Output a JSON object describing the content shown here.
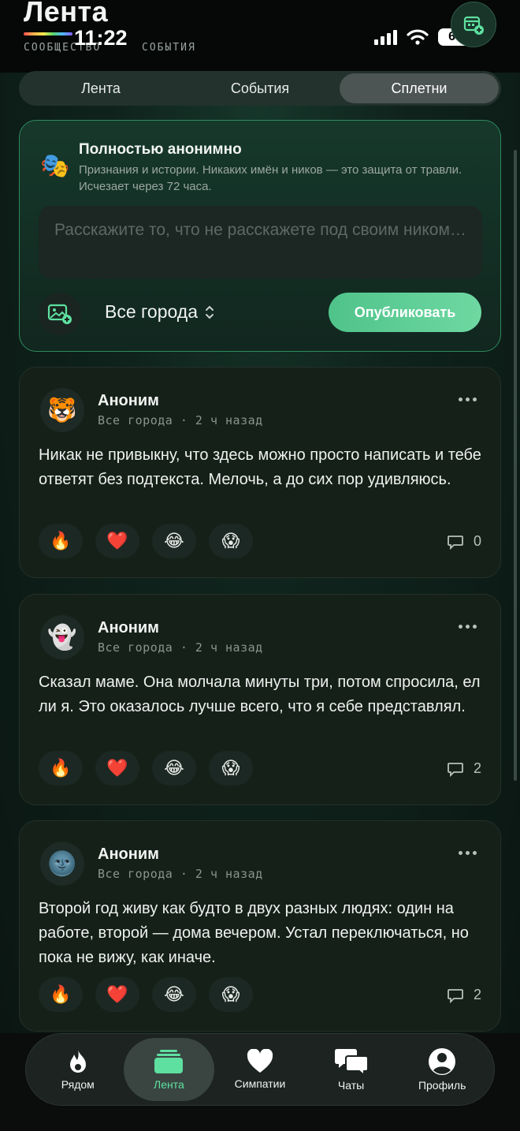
{
  "app": {
    "title": "Лента",
    "subnav": [
      "СООБЩЕСТВО",
      "СОБЫТИЯ"
    ]
  },
  "status_bar": {
    "time": "11:22",
    "battery": "66"
  },
  "segments": [
    {
      "label": "Лента",
      "active": false
    },
    {
      "label": "События",
      "active": false
    },
    {
      "label": "Сплетни",
      "active": true
    }
  ],
  "composer": {
    "icon": "theater-masks-icon",
    "title": "Полностью анонимно",
    "description": "Признания и истории. Никаких имён и ников — это защита от травли. Исчезает через 72 часа.",
    "placeholder": "Расскажите то, что не расскажете под своим ником…",
    "city": "Все города",
    "publish_label": "Опубликовать"
  },
  "posts": [
    {
      "avatar": "🐯",
      "author": "Аноним",
      "city": "Все города",
      "time": "2 ч назад",
      "text": "Никак не привыкну, что здесь можно просто написать и тебе ответят без подтекста. Мелочь, а до сих пор удивляюсь.",
      "comments": "0"
    },
    {
      "avatar": "👻",
      "author": "Аноним",
      "city": "Все города",
      "time": "2 ч назад",
      "text": "Сказал маме. Она молчала минуты три, потом спросила, ел ли я. Это оказалось лучше всего, что я себе представлял.",
      "comments": "2"
    },
    {
      "avatar": "🌚",
      "author": "Аноним",
      "city": "Все города",
      "time": "2 ч назад",
      "text": "Второй год живу как будто в двух разных людях: один на работе, второй — дома вечером. Устал переключаться, но пока не вижу, как иначе.",
      "comments": "2"
    }
  ],
  "reactions": [
    "🔥",
    "❤️",
    "😂",
    "😱"
  ],
  "tabbar": [
    {
      "label": "Рядом",
      "icon": "flame-icon"
    },
    {
      "label": "Лента",
      "icon": "feed-icon",
      "active": true
    },
    {
      "label": "Симпатии",
      "icon": "heart-icon"
    },
    {
      "label": "Чаты",
      "icon": "chat-icon"
    },
    {
      "label": "Профиль",
      "icon": "profile-icon"
    }
  ],
  "colors": {
    "accent": "#5ee0a0",
    "publish": "#4fc38a",
    "background": "#0b1210"
  }
}
